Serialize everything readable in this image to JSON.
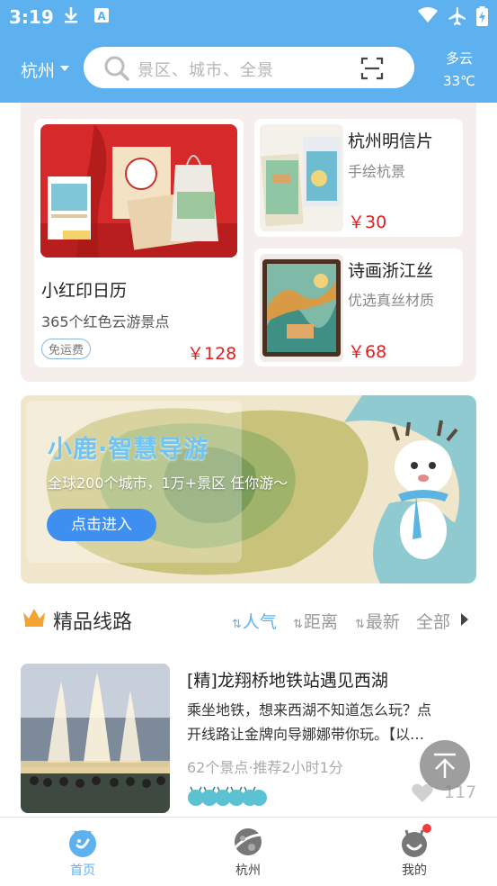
{
  "status_bar": {
    "time": "3:19"
  },
  "header": {
    "city": "杭州",
    "search_placeholder": "景区、城市、全景",
    "weather": {
      "condition": "多云",
      "temperature": "33℃"
    }
  },
  "products": [
    {
      "title": "小红印日历",
      "subtitle": "365个红色云游景点",
      "badge": "免运费",
      "price": "￥128"
    },
    {
      "title": "杭州明信片",
      "subtitle": "手绘杭景",
      "price": "￥30"
    },
    {
      "title": "诗画浙江丝",
      "subtitle": "优选真丝材质",
      "price": "￥68"
    }
  ],
  "banner": {
    "title": "小鹿·智慧导游",
    "subtitle": "全球200个城市，1万+景区 任你游～",
    "button": "点击进入"
  },
  "section": {
    "title": "精品线路",
    "sort_options": [
      "人气",
      "距离",
      "最新"
    ],
    "active_sort": "人气",
    "all_label": "全部"
  },
  "routes": [
    {
      "title": "[精]龙翔桥地铁站遇见西湖",
      "description_line1": "乘坐地铁，想来西湖不知道怎么玩？点",
      "description_line2": "开线路让金牌向导娜娜带你玩。【以…",
      "meta": "62个景点·推荐2小时1分",
      "likes": "117"
    }
  ],
  "bottom_nav": [
    {
      "label": "首页",
      "icon": "deer-home-icon",
      "active": true
    },
    {
      "label": "杭州",
      "icon": "planet-icon",
      "active": false
    },
    {
      "label": "我的",
      "icon": "profile-deer-icon",
      "active": false
    }
  ],
  "colors": {
    "primary": "#5db1ee",
    "price": "#e02020",
    "button": "#3f8ff1",
    "panel_bg": "#f6eeec"
  }
}
